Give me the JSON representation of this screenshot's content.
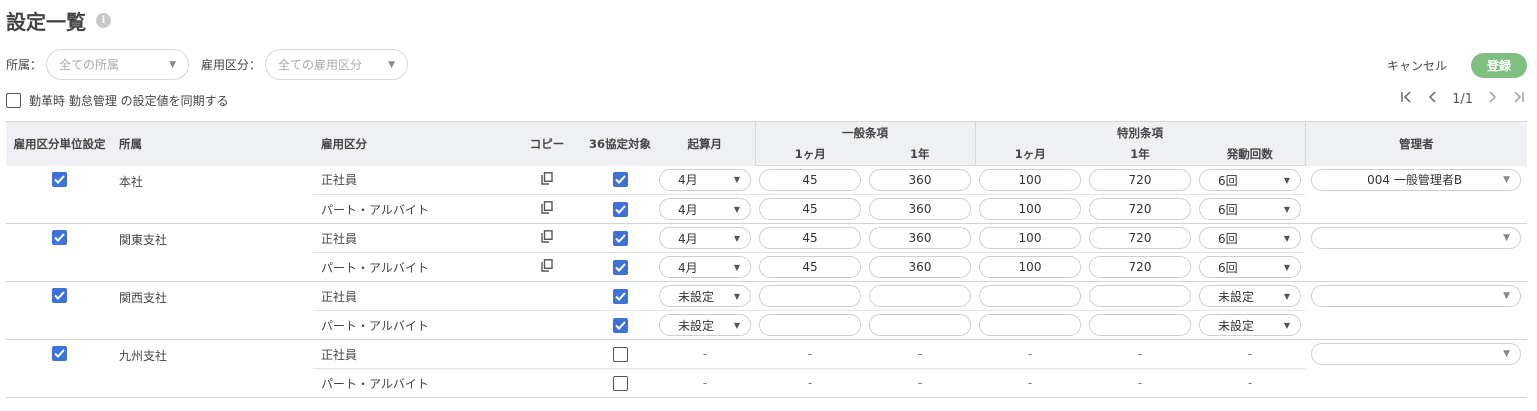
{
  "header": {
    "title": "設定一覧",
    "info_glyph": "i"
  },
  "filters": {
    "affiliation_label": "所属：",
    "affiliation_placeholder": "全ての所属",
    "employment_label": "雇用区分：",
    "employment_placeholder": "全ての雇用区分"
  },
  "sync": {
    "label": "勤革時 勤怠管理 の設定値を同期する",
    "checked": false
  },
  "actions": {
    "cancel": "キャンセル",
    "register": "登録"
  },
  "pager": {
    "first": "|‹",
    "prev": "‹",
    "page": "1/1",
    "next": "›",
    "last": "›|"
  },
  "table": {
    "headers": {
      "unit_setting": "雇用区分単位設定",
      "affiliation": "所属",
      "employment_type": "雇用区分",
      "copy": "コピー",
      "agreement36": "36協定対象",
      "start_month": "起算月",
      "general": "一般条項",
      "general_month": "1ヶ月",
      "general_year": "1年",
      "special": "特別条項",
      "special_month": "1ヶ月",
      "special_year": "1年",
      "special_count": "発動回数",
      "manager": "管理者"
    },
    "groups": [
      {
        "affiliation": "本社",
        "unit_checked": true,
        "manager": "004 一般管理者B",
        "rows": [
          {
            "type": "正社員",
            "copy": true,
            "agreement": true,
            "start_month": "4月",
            "gen_month": "45",
            "gen_year": "360",
            "sp_month": "100",
            "sp_year": "720",
            "sp_count": "6回"
          },
          {
            "type": "パート・アルバイト",
            "copy": true,
            "agreement": true,
            "start_month": "4月",
            "gen_month": "45",
            "gen_year": "360",
            "sp_month": "100",
            "sp_year": "720",
            "sp_count": "6回"
          }
        ]
      },
      {
        "affiliation": "関東支社",
        "unit_checked": true,
        "manager": "",
        "rows": [
          {
            "type": "正社員",
            "copy": true,
            "agreement": true,
            "start_month": "4月",
            "gen_month": "45",
            "gen_year": "360",
            "sp_month": "100",
            "sp_year": "720",
            "sp_count": "6回"
          },
          {
            "type": "パート・アルバイト",
            "copy": true,
            "agreement": true,
            "start_month": "4月",
            "gen_month": "45",
            "gen_year": "360",
            "sp_month": "100",
            "sp_year": "720",
            "sp_count": "6回"
          }
        ]
      },
      {
        "affiliation": "関西支社",
        "unit_checked": true,
        "manager": "",
        "rows": [
          {
            "type": "正社員",
            "copy": false,
            "agreement": true,
            "start_month": "未設定",
            "gen_month": "",
            "gen_year": "",
            "sp_month": "",
            "sp_year": "",
            "sp_count": "未設定"
          },
          {
            "type": "パート・アルバイト",
            "copy": false,
            "agreement": true,
            "start_month": "未設定",
            "gen_month": "",
            "gen_year": "",
            "sp_month": "",
            "sp_year": "",
            "sp_count": "未設定"
          }
        ]
      },
      {
        "affiliation": "九州支社",
        "unit_checked": true,
        "manager": "",
        "rows": [
          {
            "type": "正社員",
            "copy": false,
            "agreement": false,
            "disabled": true,
            "dash": "-"
          },
          {
            "type": "パート・アルバイト",
            "copy": false,
            "agreement": false,
            "disabled": true,
            "dash": "-"
          }
        ]
      }
    ]
  },
  "colors": {
    "accent_blue": "#3f72d9",
    "register_green": "#7fbf7f",
    "header_bg": "#eef0f3"
  }
}
